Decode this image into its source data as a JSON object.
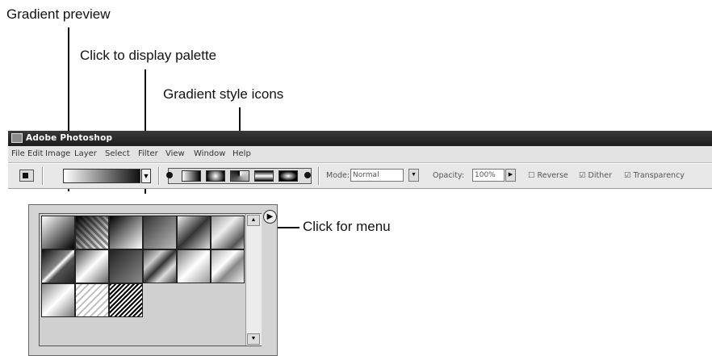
{
  "callouts": {
    "gradient_preview": "Gradient preview",
    "display_palette": "Click to display palette",
    "style_icons": "Gradient style icons",
    "menu": "Click for menu"
  },
  "window": {
    "title": "Adobe Photoshop",
    "menus": [
      "File",
      "Edit",
      "Image",
      "Layer",
      "Select",
      "Filter",
      "View",
      "Window",
      "Help"
    ]
  },
  "options_bar": {
    "mode_label": "Mode:",
    "mode_value": "Normal",
    "opacity_label": "Opacity:",
    "opacity_value": "100%",
    "reverse_label": "Reverse",
    "dither_label": "Dither",
    "transparency_label": "Transparency",
    "gradient_style_icons": [
      "linear-gradient-icon",
      "radial-gradient-icon",
      "angle-gradient-icon",
      "reflected-gradient-icon",
      "diamond-gradient-icon"
    ]
  },
  "palette": {
    "swatches": [
      "white-to-black",
      "checker-transparent",
      "black-to-white",
      "gray-diagonal",
      "gray-diagonal-2",
      "silver-diagonal",
      "dark-stripe",
      "silver-stripe",
      "dark-fade",
      "steel-stripe",
      "chrome-stripe",
      "chrome-light",
      "gray-band",
      "light-hatch",
      "dense-hatch"
    ],
    "menu_icon": "palette-menu-icon"
  },
  "colors": {
    "titlebar": "#222222",
    "panel": "#d4d4d4",
    "chrome": "#e8e8e8"
  }
}
